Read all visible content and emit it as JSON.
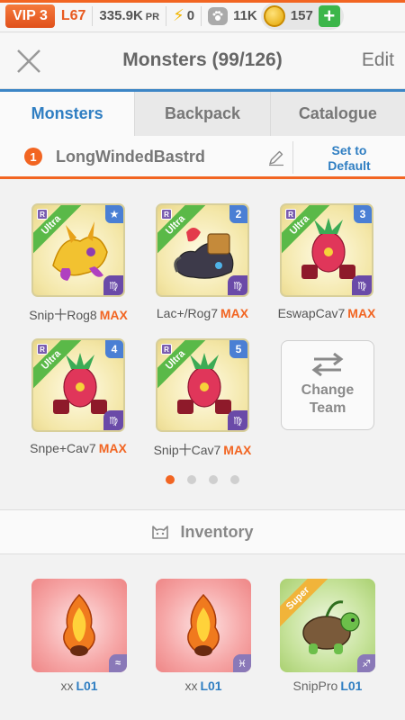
{
  "statusbar": {
    "vip": "VIP 3",
    "level": "L67",
    "power": "335.9K",
    "power_suffix": "PR",
    "energy": "0",
    "food": "11K",
    "gold": "157",
    "add_label": "+"
  },
  "header": {
    "title": "Monsters (99/126)",
    "edit_label": "Edit"
  },
  "tabs": [
    {
      "label": "Monsters",
      "active": true
    },
    {
      "label": "Backpack",
      "active": false
    },
    {
      "label": "Catalogue",
      "active": false
    }
  ],
  "team": {
    "number": "1",
    "name": "LongWindedBastrd",
    "set_default_line1": "Set to",
    "set_default_line2": "Default"
  },
  "team_monsters": [
    {
      "name": "Snip十Rog8",
      "max": "MAX",
      "rank": "Ultra",
      "slot": "★",
      "rarity": "R",
      "element": "♍",
      "art": "gold-dragon"
    },
    {
      "name": "Lac+/Rog7",
      "max": "MAX",
      "rank": "Ultra",
      "slot": "2",
      "rarity": "R",
      "element": "♍",
      "art": "dark-beast"
    },
    {
      "name": "EswapCav7",
      "max": "MAX",
      "rank": "Ultra",
      "slot": "3",
      "rarity": "R",
      "element": "♍",
      "art": "red-cavalier"
    },
    {
      "name": "Snpe+Cav7",
      "max": "MAX",
      "rank": "Ultra",
      "slot": "4",
      "rarity": "R",
      "element": "♍",
      "art": "red-cavalier"
    },
    {
      "name": "Snip十Cav7",
      "max": "MAX",
      "rank": "Ultra",
      "slot": "5",
      "rarity": "R",
      "element": "♍",
      "art": "red-cavalier"
    }
  ],
  "change_team": {
    "line1": "Change",
    "line2": "Team"
  },
  "pager": {
    "pages": 4,
    "current": 0
  },
  "inventory": {
    "title": "Inventory",
    "items": [
      {
        "name": "xx",
        "level": "L01",
        "element": "≈",
        "card": "red",
        "art": "fire-sprite"
      },
      {
        "name": "xx",
        "level": "L01",
        "element": "♓",
        "card": "red",
        "art": "fire-sprite"
      },
      {
        "name": "SnipPro",
        "level": "L01",
        "element": "♐",
        "card": "green",
        "rank": "Super",
        "art": "turtle"
      }
    ]
  },
  "colors": {
    "accent_orange": "#f26522",
    "accent_blue": "#2f7ec2",
    "ultra_green": "#5ab948",
    "super_gold": "#f1b43a"
  }
}
